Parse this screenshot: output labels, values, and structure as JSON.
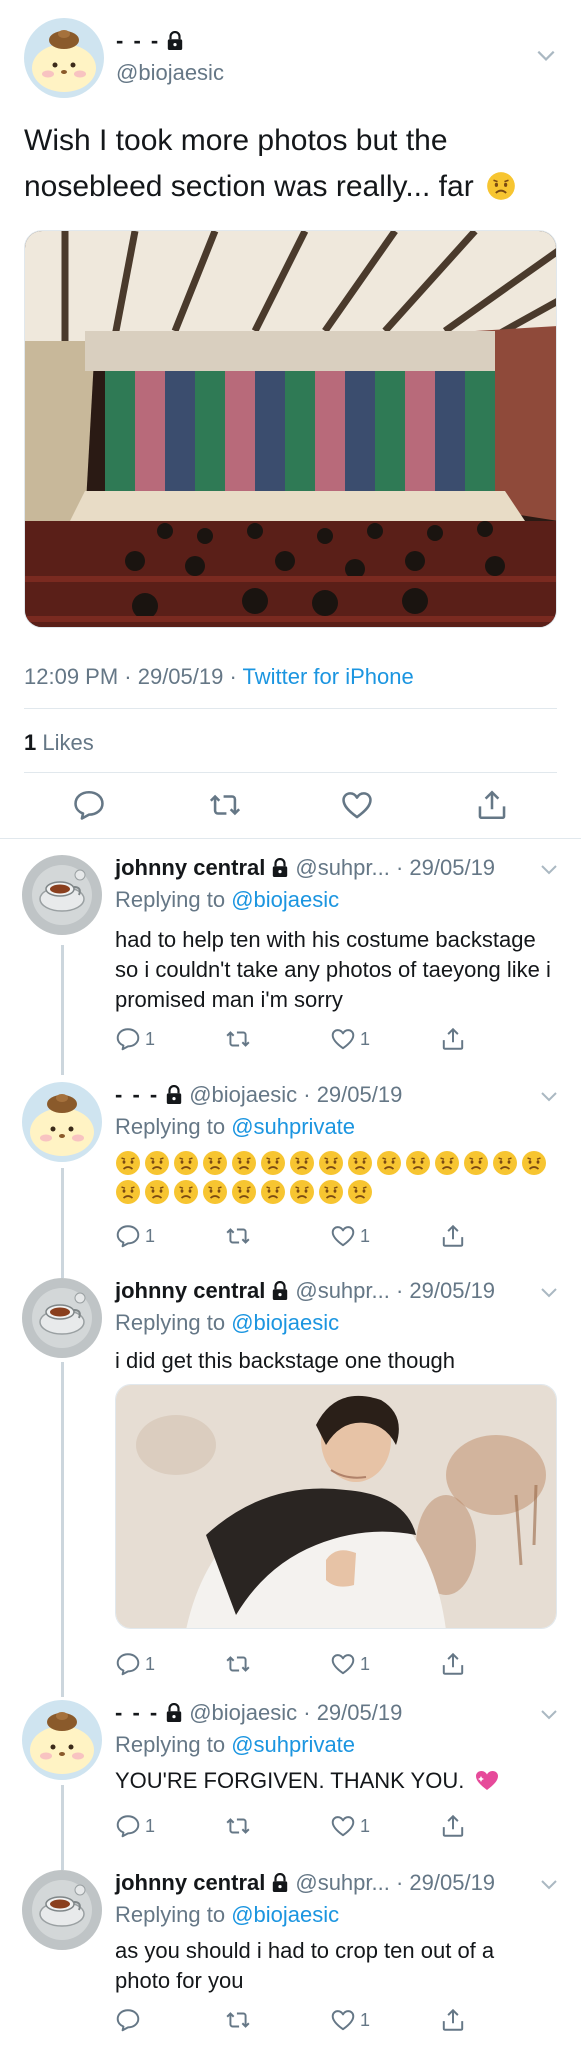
{
  "main_tweet": {
    "display_name": "- - -",
    "handle": "@biojaesic",
    "text": "Wish I took more photos but the nosebleed section was really... far",
    "time": "12:09 PM · 29/05/19 · ",
    "source": "Twitter for iPhone",
    "likes_count": "1",
    "likes_label": " Likes",
    "actions": [
      "reply-icon",
      "retweet-icon",
      "like-icon",
      "share-icon"
    ]
  },
  "replies": [
    {
      "name": "johnny central",
      "handle": "@suhpr... · 29/05/19",
      "replying_prefix": "Replying to ",
      "replying_to": "@biojaesic",
      "text": "had to help ten with his costume backstage so i couldn't take any photos of taeyong like i promised man i'm sorry",
      "reply_count": "1",
      "like_count": "1"
    },
    {
      "name": "- - -",
      "handle": "@biojaesic · 29/05/19",
      "replying_prefix": "Replying to ",
      "replying_to": "@suhprivate",
      "text": "",
      "reply_count": "1",
      "like_count": "1"
    },
    {
      "name": "johnny central",
      "handle": "@suhpr... · 29/05/19",
      "replying_prefix": "Replying to ",
      "replying_to": "@biojaesic",
      "text": "i did get this backstage one though",
      "reply_count": "1",
      "like_count": "1"
    },
    {
      "name": "- - -",
      "handle": "@biojaesic · 29/05/19",
      "replying_prefix": "Replying to ",
      "replying_to": "@suhprivate",
      "text": "YOU'RE FORGIVEN. THANK YOU.",
      "reply_count": "1",
      "like_count": "1"
    },
    {
      "name": "johnny central",
      "handle": "@suhpr... · 29/05/19",
      "replying_prefix": "Replying to ",
      "replying_to": "@biojaesic",
      "text": "as you should i had to crop ten out of a photo for you",
      "reply_count": "",
      "like_count": "1"
    }
  ],
  "colors": {
    "link": "#1b95e0",
    "secondary": "#657786",
    "divider": "#e1e8ed",
    "thread": "#ccd6dd"
  }
}
